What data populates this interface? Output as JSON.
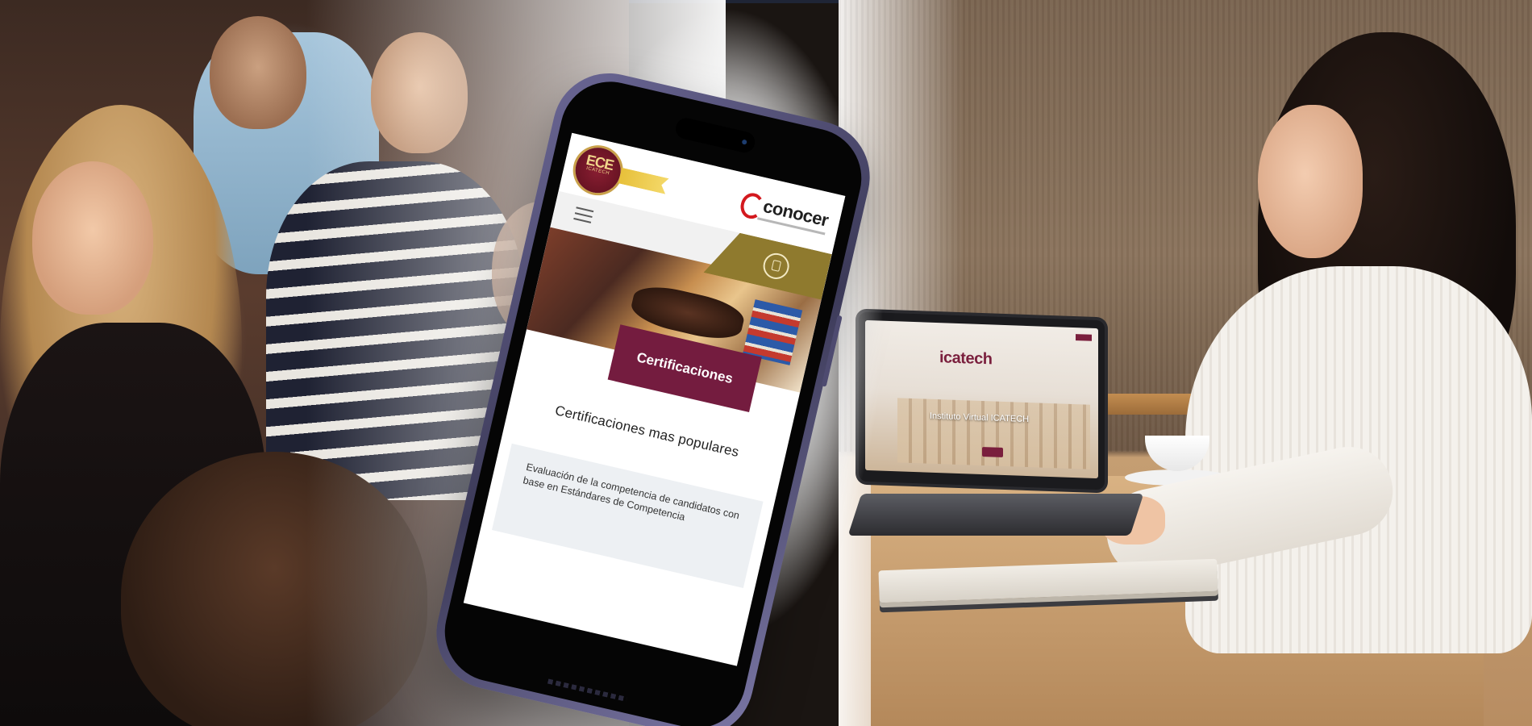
{
  "phone": {
    "ece_logo": "ECE",
    "ece_subtext": "ICATECH",
    "conocer_logo": "conocer",
    "hero_button": "Certificaciones",
    "section_title": "Certificaciones mas populares",
    "card_text": "Evaluación de la competencia de candidatos con base en Estándares de Competencia"
  },
  "laptop": {
    "logo": "icatech",
    "title": "Instituto Virtual ICATECH"
  },
  "colors": {
    "brand_maroon": "#741c3f",
    "brand_gold": "#8f7a2e",
    "conocer_red": "#d3191e"
  }
}
